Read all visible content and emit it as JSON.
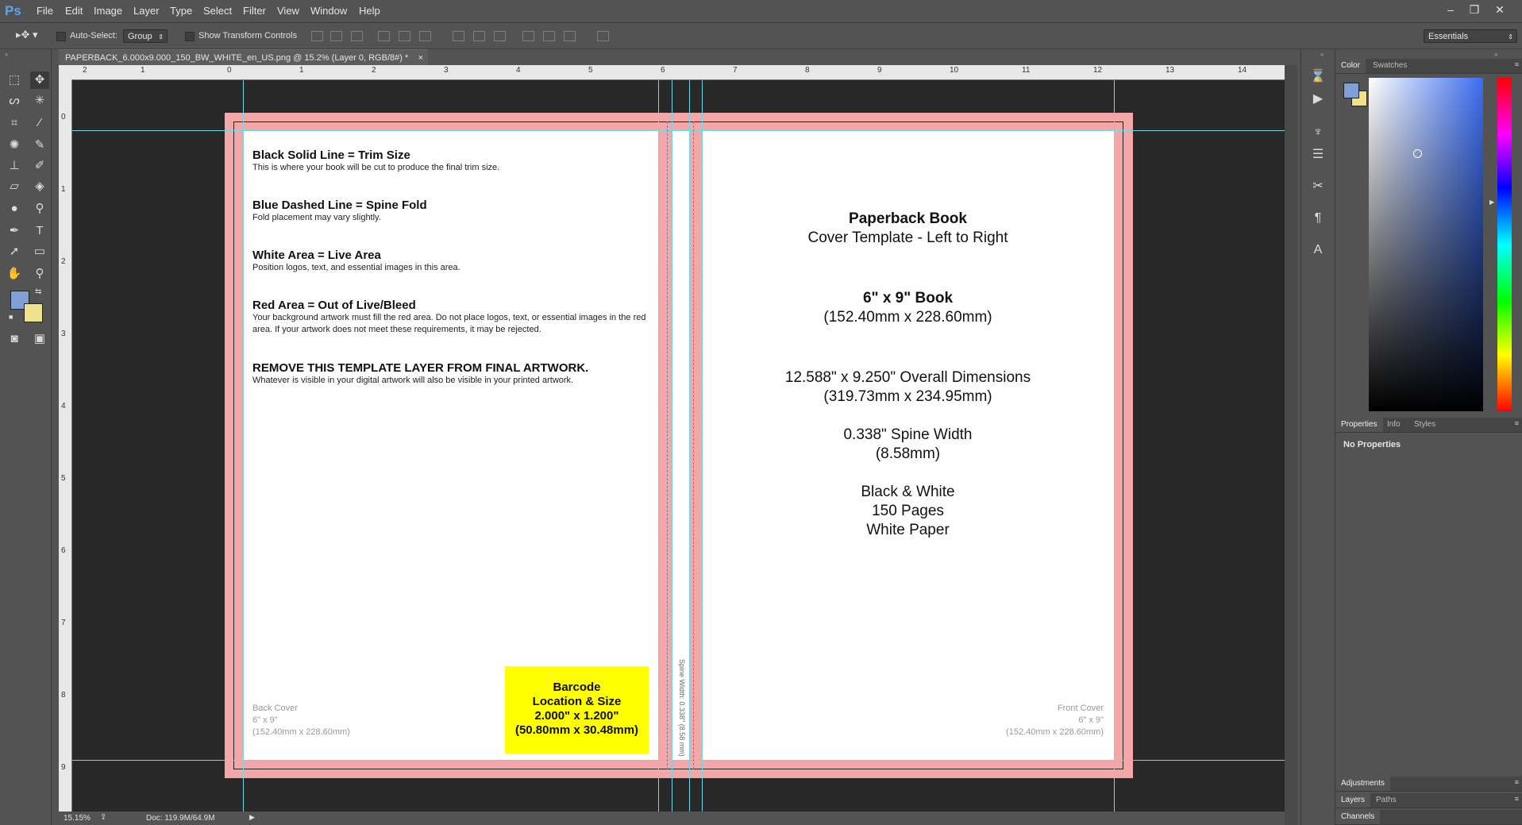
{
  "app": {
    "logo": "Ps",
    "menu": [
      "File",
      "Edit",
      "Image",
      "Layer",
      "Type",
      "Select",
      "Filter",
      "View",
      "Window",
      "Help"
    ],
    "window_controls": {
      "minimize": "–",
      "restore": "❐",
      "close": "✕"
    }
  },
  "options": {
    "auto_select_label": "Auto-Select:",
    "auto_select_value": "Group",
    "transform_label": "Show Transform Controls",
    "workspace": "Essentials"
  },
  "document": {
    "tab_title": "PAPERBACK_6.000x9.000_150_BW_WHITE_en_US.png @ 15.2% (Layer 0, RGB/8#) *",
    "close_glyph": "×"
  },
  "rulers": {
    "top": [
      "2",
      "1",
      "0",
      "1",
      "2",
      "3",
      "4",
      "5",
      "6",
      "7",
      "8",
      "9",
      "10",
      "11",
      "12",
      "13",
      "14"
    ],
    "left": [
      "0",
      "1",
      "2",
      "3",
      "4",
      "5",
      "6",
      "7",
      "8",
      "9"
    ]
  },
  "template": {
    "back": {
      "sections": [
        {
          "heading": "Black Solid Line = Trim Size",
          "body": "This is where your book will be cut to produce the final trim size."
        },
        {
          "heading": "Blue Dashed Line = Spine Fold",
          "body": "Fold placement may vary slightly."
        },
        {
          "heading": "White Area = Live Area",
          "body": "Position logos, text, and essential images in this area."
        },
        {
          "heading": "Red Area = Out of Live/Bleed",
          "body": "Your background artwork must fill the red area. Do not place logos, text, or essential images in the red area. If your artwork does not meet these requirements, it may be rejected."
        },
        {
          "heading": "REMOVE THIS TEMPLATE LAYER FROM FINAL ARTWORK.",
          "body": "Whatever is visible in your digital artwork will also be visible in your printed artwork."
        }
      ],
      "cover_label": "Back Cover",
      "cover_size": "6\" x 9\"",
      "cover_mm": "(152.40mm x 228.60mm)"
    },
    "barcode": {
      "line1": "Barcode",
      "line2": "Location & Size",
      "line3": "2.000\" x 1.200\"",
      "line4": "(50.80mm x 30.48mm)"
    },
    "spine_text": "Spine Width: 0.338\" (8.58 mm)",
    "front": {
      "title": "Paperback Book",
      "subtitle": "Cover Template - Left to Right",
      "book_size": "6\" x 9\" Book",
      "book_size_mm": "(152.40mm x 228.60mm)",
      "overall": "12.588\" x 9.250\" Overall Dimensions",
      "overall_mm": "(319.73mm x 234.95mm)",
      "spine": "0.338\" Spine Width",
      "spine_mm": "(8.58mm)",
      "color": "Black & White",
      "pages": "150 Pages",
      "paper": "White Paper",
      "cover_label": "Front Cover",
      "cover_size": "6\" x 9\"",
      "cover_mm": "(152.40mm x 228.60mm)"
    }
  },
  "status": {
    "zoom": "15.15%",
    "doc": "Doc: 119.9M/64.9M"
  },
  "panels": {
    "color_tabs": [
      "Color",
      "Swatches"
    ],
    "props_tabs": [
      "Properties",
      "Info",
      "Styles"
    ],
    "no_properties": "No Properties",
    "adjustments": "Adjustments",
    "layers_tabs": [
      "Layers",
      "Paths"
    ],
    "channels": "Channels"
  },
  "colors": {
    "foreground": "#7f9fd6",
    "background": "#efe08a",
    "bleed": "#f4a7a7",
    "guide": "#6fd8e8",
    "barcode": "#ffff00"
  }
}
